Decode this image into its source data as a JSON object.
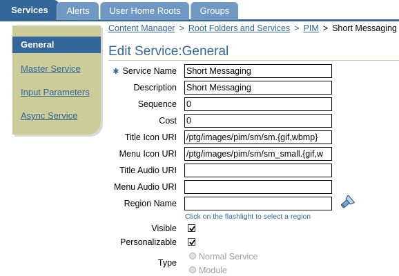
{
  "tabs": [
    {
      "label": "Services",
      "active": true
    },
    {
      "label": "Alerts",
      "active": false
    },
    {
      "label": "User Home Roots",
      "active": false
    },
    {
      "label": "Groups",
      "active": false
    }
  ],
  "sidebar": {
    "active": "General",
    "links": [
      "Master Service",
      "Input Parameters",
      "Async Service"
    ]
  },
  "breadcrumb": {
    "items": [
      "Content Manager",
      "Root Folders and Services",
      "PIM"
    ],
    "current": "Short Messaging",
    "separator": ">"
  },
  "title": "Edit Service:General",
  "required_marker": "✱",
  "form": {
    "service_name": {
      "label": "Service Name",
      "value": "Short Messaging"
    },
    "description": {
      "label": "Description",
      "value": "Short Messaging"
    },
    "sequence": {
      "label": "Sequence",
      "value": "0"
    },
    "cost": {
      "label": "Cost",
      "value": "0"
    },
    "title_icon_uri": {
      "label": "Title Icon URI",
      "value": "/ptg/images/pim/sm/sm.{gif,wbmp}"
    },
    "menu_icon_uri": {
      "label": "Menu Icon URI",
      "value": "/ptg/images/pim/sm/sm_small.{gif,w"
    },
    "title_audio_uri": {
      "label": "Title Audio URI",
      "value": ""
    },
    "menu_audio_uri": {
      "label": "Menu Audio URI",
      "value": ""
    },
    "region_name": {
      "label": "Region Name",
      "value": ""
    },
    "region_hint": "Click on the flashlight to select a region",
    "visible": {
      "label": "Visible",
      "checked": true
    },
    "personalizable": {
      "label": "Personalizable",
      "checked": true
    },
    "type": {
      "label": "Type",
      "options": [
        "Normal Service",
        "Module"
      ],
      "selected": "Module"
    }
  },
  "icons": {
    "required": "asterisk-icon",
    "region_picker": "flashlight-icon",
    "check": "check-icon"
  },
  "colors": {
    "brand": "#336699",
    "sidebar": "#cccc99",
    "tab_inactive": "#6f98c2"
  }
}
